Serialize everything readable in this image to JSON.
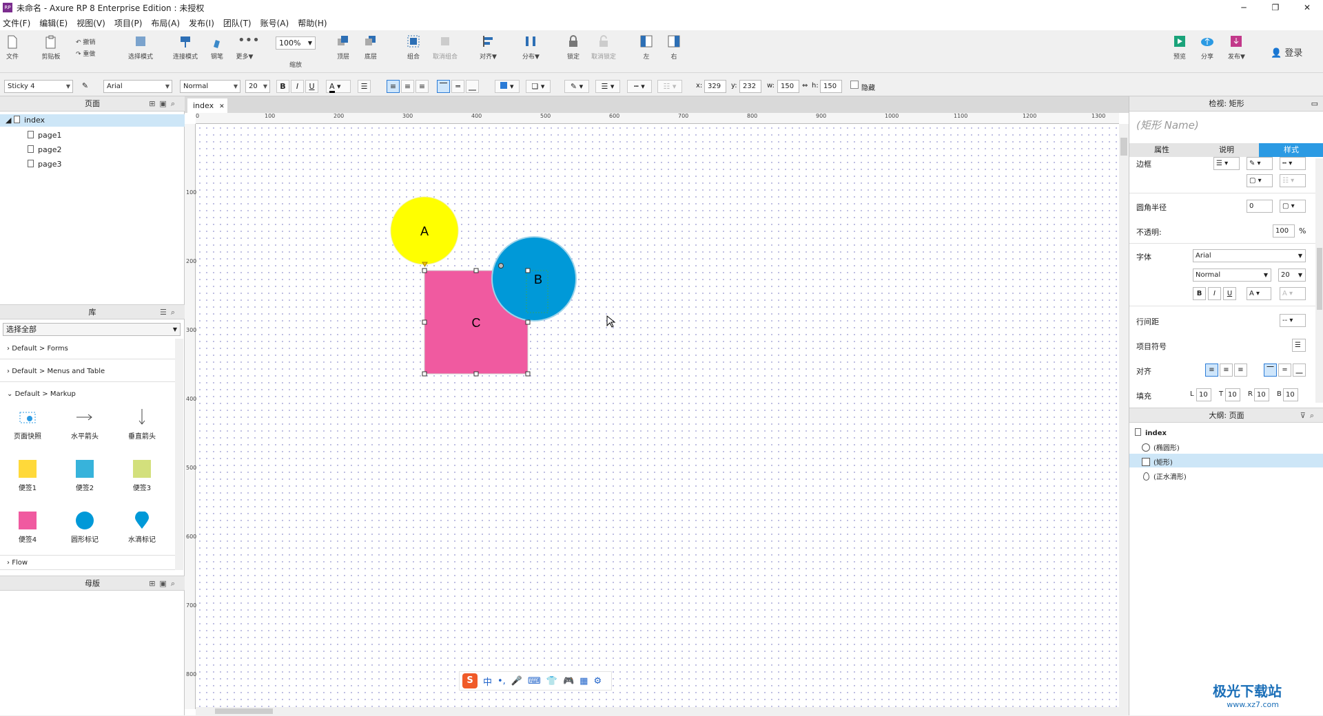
{
  "window": {
    "title": "未命名 - Axure RP 8 Enterprise Edition : 未授权",
    "app_icon": "RP"
  },
  "menu": [
    "文件(F)",
    "编辑(E)",
    "视图(V)",
    "项目(P)",
    "布局(A)",
    "发布(I)",
    "团队(T)",
    "账号(A)",
    "帮助(H)"
  ],
  "toolbar": {
    "file": "文件",
    "clipboard": "剪贴板",
    "undo": "撤销",
    "redo": "重做",
    "select_mode": "选择模式",
    "connect_mode": "连接模式",
    "pen": "钢笔",
    "more": "更多▼",
    "zoom_value": "100%",
    "zoom_label": "缩放",
    "top": "顶层",
    "bottom": "底层",
    "group": "组合",
    "ungroup": "取消组合",
    "align": "对齐▼",
    "distribute": "分布▼",
    "lock": "锁定",
    "unlock": "取消锁定",
    "left": "左",
    "right": "右",
    "preview": "预览",
    "share": "分享",
    "publish": "发布▼",
    "login": "登录"
  },
  "format": {
    "style": "Sticky 4",
    "font": "Arial",
    "weight": "Normal",
    "size": "20",
    "x_label": "x:",
    "x": "329",
    "y_label": "y:",
    "y": "232",
    "w_label": "w:",
    "w": "150",
    "h_label": "h:",
    "h": "150",
    "hidden": "隐藏"
  },
  "pages_panel": {
    "title": "页面",
    "root": "index",
    "pages": [
      "page1",
      "page2",
      "page3"
    ]
  },
  "library_panel": {
    "title": "库",
    "select": "选择全部",
    "groups": [
      "Default > Forms",
      "Default > Menus and Table",
      "Default > Markup"
    ],
    "widgets": [
      "页面快照",
      "水平箭头",
      "垂直箭头",
      "便签1",
      "便签2",
      "便签3",
      "便签4",
      "圆形标记",
      "水滴标记"
    ],
    "flow": "Flow"
  },
  "masters_panel": {
    "title": "母版"
  },
  "canvas": {
    "tab": "index",
    "ruler_h": [
      "0",
      "100",
      "200",
      "300",
      "400",
      "500",
      "600",
      "700",
      "800",
      "900",
      "1000",
      "1100",
      "1200",
      "1300"
    ],
    "ruler_v": [
      "100",
      "200",
      "300",
      "400",
      "500",
      "600",
      "700",
      "800"
    ],
    "shapes": {
      "a": "A",
      "b": "B",
      "c": "C"
    }
  },
  "inspector": {
    "title": "检视: 矩形",
    "name_placeholder": "(矩形 Name)",
    "tabs": [
      "属性",
      "说明",
      "样式"
    ],
    "border": "边框",
    "corner": "圆角半径",
    "corner_value": "0",
    "opacity": "不透明:",
    "opacity_value": "100",
    "opacity_unit": "%",
    "font_label": "字体",
    "font": "Arial",
    "weight": "Normal",
    "size": "20",
    "line_spacing": "行间距",
    "line_spacing_value": "--",
    "bullets": "项目符号",
    "align": "对齐",
    "padding": "填充",
    "pad": {
      "l_label": "L",
      "l": "10",
      "t_label": "T",
      "t": "10",
      "r_label": "R",
      "r": "10",
      "b_label": "B",
      "b": "10"
    }
  },
  "outline": {
    "title": "大纲: 页面",
    "root": "index",
    "items": [
      "(椭圆形)",
      "(矩形)",
      "(正水滴形)"
    ]
  },
  "ime": {
    "items": [
      "中",
      "•,",
      "🎤",
      "⌨",
      "👕",
      "🎮",
      "▦",
      "⚙"
    ]
  },
  "watermark": {
    "title": "极光下载站",
    "url": "www.xz7.com"
  },
  "colors": {
    "yellow": "#ffff00",
    "blue": "#0099d8",
    "pink": "#f05aa0",
    "accent": "#2b9ae3"
  }
}
